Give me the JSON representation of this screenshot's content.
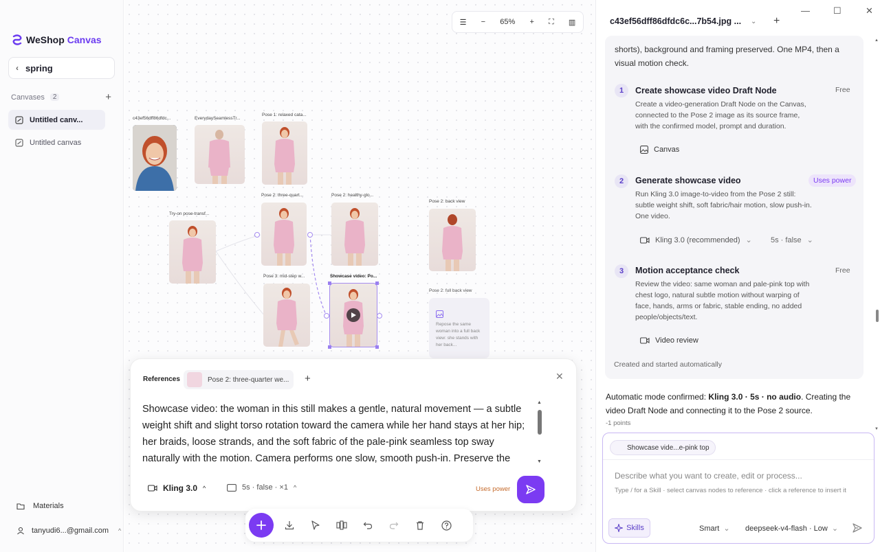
{
  "sidebar": {
    "logo_primary": "WeShop",
    "logo_secondary": "Canvas",
    "project_name": "spring",
    "canvases_label": "Canvases",
    "canvases_count": "2",
    "canvases": [
      {
        "label": "Untitled canv..."
      },
      {
        "label": "Untitled canvas"
      }
    ],
    "materials_label": "Materials",
    "account_email": "tanyudi6...@gmail.com"
  },
  "canvas": {
    "zoom": "65%",
    "nodes": [
      {
        "label": "c43ef56dff86dfdc..."
      },
      {
        "label": "EverydaySeamlessTr..."
      },
      {
        "label": "Pose 1: relaxed cata..."
      },
      {
        "label": "Try-on pose-transf..."
      },
      {
        "label": "Pose 2: three-quart..."
      },
      {
        "label": "Pose 2: healthy-glo..."
      },
      {
        "label": "Pose 2: back view"
      },
      {
        "label": "Pose 3: mid-step w..."
      },
      {
        "label": "Showcase video: Po..."
      },
      {
        "label": "Pose 2: full back view"
      }
    ],
    "draft_text": "Repose the same woman into a full back view: she stands with her back..."
  },
  "composer": {
    "references_label": "References",
    "reference_chip": "Pose 2: three-quarter we...",
    "prompt": "Showcase video: the woman in this still makes a gentle, natural movement — a subtle weight shift and slight torso rotation toward the camera while her hand stays at her hip; her braids, loose strands, and the soft fabric of the pale-pink seamless top sway naturally with the motion. Camera performs one slow, smooth push-in. Preserve the",
    "model": "Kling 3.0",
    "options": "5s · false · ×1",
    "uses_power": "Uses power"
  },
  "right_panel": {
    "tab_title": "c43ef56dff86dfdc6c...7b54.jpg ...",
    "plan_intro": "shorts), background and framing preserved. One MP4, then a visual motion check.",
    "steps": [
      {
        "num": "1",
        "title": "Create showcase video Draft Node",
        "cost": "Free",
        "desc": "Create a video-generation Draft Node on the Canvas, connected to the Pose 2 image as its source frame, with the confirmed model, prompt and duration.",
        "tool": "Canvas"
      },
      {
        "num": "2",
        "title": "Generate showcase video",
        "cost": "Uses power",
        "desc": "Run Kling 3.0 image-to-video from the Pose 2 still: subtle weight shift, soft fabric/hair motion, slow push-in. One video.",
        "tool": "Kling 3.0 (recommended)",
        "tool_opt": "5s · false"
      },
      {
        "num": "3",
        "title": "Motion acceptance check",
        "cost": "Free",
        "desc": "Review the video: same woman and pale-pink top with chest logo, natural subtle motion without warping of face, hands, arms or fabric, stable ending, no added people/objects/text.",
        "tool": "Video review"
      }
    ],
    "auto_created": "Created and started automatically",
    "confirm_prefix": "Automatic mode confirmed: ",
    "confirm_bold": "Kling 3.0 · 5s · no audio",
    "confirm_suffix": ". Creating the video Draft Node and connecting it to the Pose 2 source.",
    "points": "-1 points",
    "chat": {
      "chip": "Showcase vide...e-pink top",
      "placeholder": "Describe what you want to create, edit or process...",
      "hint": "Type / for a Skill · select canvas nodes to reference · click a reference to insert it",
      "skills_label": "Skills",
      "mode": "Smart",
      "model": "deepseek-v4-flash · Low"
    }
  },
  "colors": {
    "accent": "#7b3bf2",
    "power": "#c56a2b"
  }
}
